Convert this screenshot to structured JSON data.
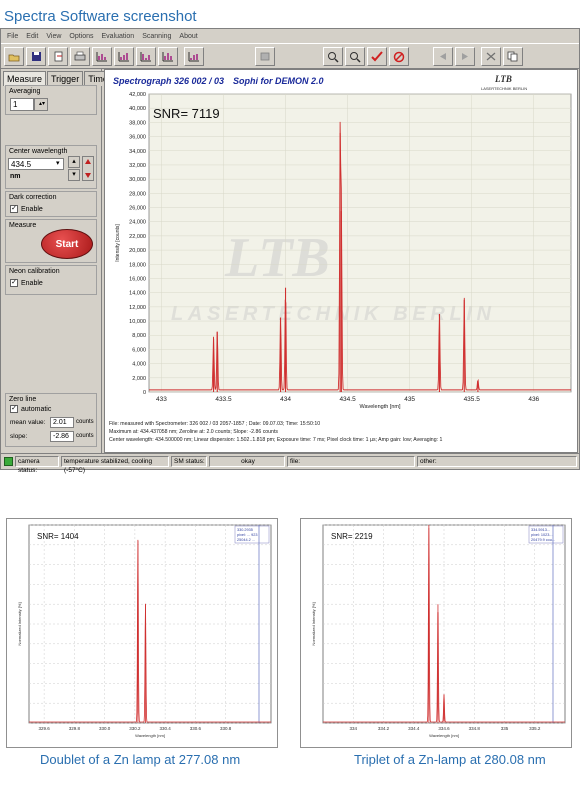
{
  "page_title": "Spectra Software screenshot",
  "menu": [
    "File",
    "Edit",
    "View",
    "Options",
    "Evaluation",
    "Scanning",
    "About"
  ],
  "left_panel": {
    "tabs": [
      "Measure",
      "Trigger",
      "Time"
    ],
    "averaging_label": "Averaging",
    "averaging_value": "1",
    "center_wavelength_label": "Center wavelength",
    "center_wavelength_value": "434.5",
    "unit": "nm",
    "dark_correction_label": "Dark correction",
    "dark_enable": "Enable",
    "measure_label": "Measure",
    "start_label": "Start",
    "neon_label": "Neon calibration",
    "neon_enable": "Enable",
    "zero_line_label": "Zero line",
    "automatic_label": "automatic",
    "mean_value_label": "mean value:",
    "mean_value": "2.01",
    "slope_label": "slope:",
    "slope_value": "-2.86",
    "counts": "counts"
  },
  "plot_header": {
    "title": "Spectrograph 326 002 / 03",
    "subtitle": "Sophi for DEMON 2.0",
    "logo": "LTB",
    "logo_sub": "LASERTECHNIK BERLIN"
  },
  "plot_info": [
    "File:  measured with Spectrometer: 326 002 / 03 2057-1857 ; Date: 09.07.03; Time: 15:50:10",
    "Maximum at: 434.437058 nm; Zeroline at: 2.0 counts; Slope: -2.86 counts",
    "Center wavelength: 434.500000 nm; Linear dispersion: 1.502..1.818 pm; Exposure time: 7 ms; Pixel clock time: 1 µs; Amp gain: low; Averaging: 1"
  ],
  "status_bar": {
    "camera_label": "camera status:",
    "camera_value": "temperature stabilized, cooling (-57°C)",
    "sm_label": "SM status:",
    "sm_value": "okay",
    "file_label": "file:",
    "other_label": "other:"
  },
  "captions": {
    "left": "Doublet of a Zn lamp at 277.08 nm",
    "right": "Triplet of a Zn-lamp at 280.08 nm"
  },
  "colors": {
    "accent": "#2a6fb0",
    "trace": "#d03030",
    "watermark": "#c8c8c8"
  },
  "chart_data": [
    {
      "type": "line",
      "title": "",
      "annotation": "SNR= 7119",
      "xlabel": "Wavelength [nm]",
      "ylabel": "Intensity [counts]",
      "xlim": [
        432.9,
        436.3
      ],
      "ylim": [
        0,
        42000
      ],
      "xticks": [
        "433",
        "433.5",
        "434",
        "434.5",
        "435",
        "435.5",
        "436"
      ],
      "xtick_values": [
        433,
        433.5,
        434,
        434.5,
        435,
        435.5,
        436
      ],
      "yticks": [
        "0",
        "2,000",
        "4,000",
        "6,000",
        "8,000",
        "10,000",
        "12,000",
        "14,000",
        "16,000",
        "18,000",
        "20,000",
        "22,000",
        "24,000",
        "26,000",
        "28,000",
        "30,000",
        "32,000",
        "34,000",
        "36,000",
        "38,000",
        "40,000",
        "42,000"
      ],
      "ytick_values": [
        0,
        2000,
        4000,
        6000,
        8000,
        10000,
        12000,
        14000,
        16000,
        18000,
        20000,
        22000,
        24000,
        26000,
        28000,
        30000,
        32000,
        34000,
        36000,
        38000,
        40000,
        42000
      ],
      "peaks": [
        {
          "x": 433.42,
          "y": 7500
        },
        {
          "x": 433.45,
          "y": 8500
        },
        {
          "x": 433.96,
          "y": 10500
        },
        {
          "x": 434.0,
          "y": 14700
        },
        {
          "x": 434.44,
          "y": 36500
        },
        {
          "x": 434.45,
          "y": 25500
        },
        {
          "x": 435.24,
          "y": 11000
        },
        {
          "x": 435.44,
          "y": 13000
        },
        {
          "x": 435.55,
          "y": 1500
        }
      ]
    },
    {
      "type": "line",
      "annotation": "SNR= 1404",
      "xlim": [
        329.5,
        331.1
      ],
      "ylim": [
        0,
        100
      ],
      "xticks": [
        "329.6",
        "329.8",
        "330.0",
        "330.2",
        "330.4",
        "330.6",
        "330.8"
      ],
      "xtick_values": [
        329.6,
        329.8,
        330.0,
        330.2,
        330.4,
        330.6,
        330.8
      ],
      "xlabel": "Wavelength [nm]",
      "ylabel": "Normalized Intensity [%]",
      "legend": [
        "330.2935",
        "pixel: ... 923",
        "25044.2 ..."
      ],
      "peaks": [
        {
          "x": 330.22,
          "y": 92
        },
        {
          "x": 330.27,
          "y": 60
        }
      ]
    },
    {
      "type": "line",
      "annotation": "SNR= 2219",
      "xlim": [
        333.8,
        335.4
      ],
      "ylim": [
        0,
        100
      ],
      "xticks": [
        "334",
        "334.2",
        "334.4",
        "334.6",
        "334.8",
        "335",
        "335.2"
      ],
      "xtick_values": [
        334.0,
        334.2,
        334.4,
        334.6,
        334.8,
        335.0,
        335.2
      ],
      "xlabel": "Wavelength [nm]",
      "ylabel": "Normalized Intensity [%]",
      "legend": [
        "334.5913...",
        "pixel: 1023...",
        "20479.9 cou..."
      ],
      "peaks": [
        {
          "x": 334.5,
          "y": 100
        },
        {
          "x": 334.56,
          "y": 60
        },
        {
          "x": 334.6,
          "y": 14
        }
      ]
    }
  ]
}
